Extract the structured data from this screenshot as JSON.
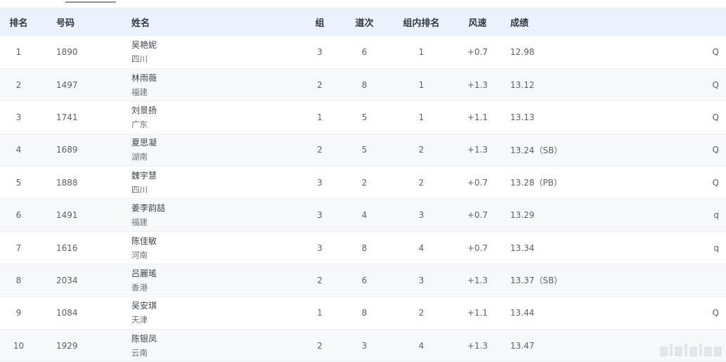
{
  "headers": {
    "rank": "排名",
    "bib": "号码",
    "name": "姓名",
    "group": "组",
    "lane": "道次",
    "group_rank": "组内排名",
    "wind": "风速",
    "result": "成绩"
  },
  "rows": [
    {
      "rank": "1",
      "bib": "1890",
      "name": "吴艳妮",
      "team": "四川",
      "group": "3",
      "lane": "6",
      "group_rank": "1",
      "wind": "+0.7",
      "result": "12.98",
      "qual": "Q"
    },
    {
      "rank": "2",
      "bib": "1497",
      "name": "林雨薇",
      "team": "福建",
      "group": "2",
      "lane": "8",
      "group_rank": "1",
      "wind": "+1.3",
      "result": "13.12",
      "qual": "Q"
    },
    {
      "rank": "3",
      "bib": "1741",
      "name": "刘景扬",
      "team": "广东",
      "group": "1",
      "lane": "5",
      "group_rank": "1",
      "wind": "+1.1",
      "result": "13.13",
      "qual": "Q"
    },
    {
      "rank": "4",
      "bib": "1689",
      "name": "夏思凝",
      "team": "湖南",
      "group": "2",
      "lane": "5",
      "group_rank": "2",
      "wind": "+1.3",
      "result": "13.24（SB）",
      "qual": "Q"
    },
    {
      "rank": "5",
      "bib": "1888",
      "name": "魏宇慧",
      "team": "四川",
      "group": "3",
      "lane": "2",
      "group_rank": "2",
      "wind": "+0.7",
      "result": "13.28（PB）",
      "qual": "Q"
    },
    {
      "rank": "6",
      "bib": "1491",
      "name": "姜李韵喆",
      "team": "福建",
      "group": "3",
      "lane": "4",
      "group_rank": "3",
      "wind": "+0.7",
      "result": "13.29",
      "qual": "q"
    },
    {
      "rank": "7",
      "bib": "1616",
      "name": "陈佳敏",
      "team": "河南",
      "group": "3",
      "lane": "8",
      "group_rank": "4",
      "wind": "+0.7",
      "result": "13.34",
      "qual": "q"
    },
    {
      "rank": "8",
      "bib": "2034",
      "name": "吕麗瑤",
      "team": "香港",
      "group": "2",
      "lane": "6",
      "group_rank": "3",
      "wind": "+1.3",
      "result": "13.37（SB）",
      "qual": ""
    },
    {
      "rank": "9",
      "bib": "1084",
      "name": "吴安琪",
      "team": "天津",
      "group": "1",
      "lane": "8",
      "group_rank": "2",
      "wind": "+1.1",
      "result": "13.44",
      "qual": "Q"
    },
    {
      "rank": "10",
      "bib": "1929",
      "name": "陈银凤",
      "team": "云南",
      "group": "2",
      "lane": "3",
      "group_rank": "4",
      "wind": "+1.3",
      "result": "13.47",
      "qual": ""
    }
  ]
}
